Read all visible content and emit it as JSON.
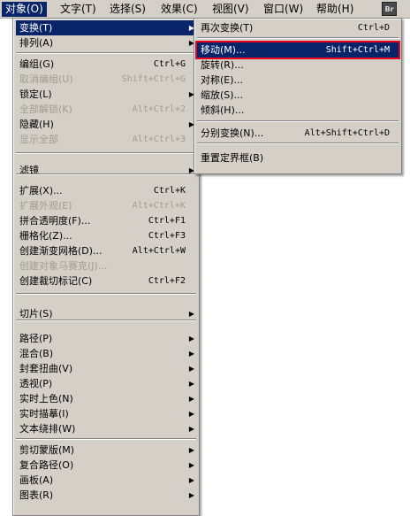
{
  "menubar": {
    "items": [
      "对象(O)",
      "文字(T)",
      "选择(S)",
      "效果(C)",
      "视图(V)",
      "窗口(W)",
      "帮助(H)"
    ],
    "bridge_icon": "Br"
  },
  "main_menu": [
    {
      "label": "变换(T)",
      "shortcut": "",
      "submenu": true,
      "disabled": false,
      "highlight": true
    },
    {
      "label": "排列(A)",
      "shortcut": "",
      "submenu": true,
      "disabled": false
    },
    {
      "label": "编组(G)",
      "shortcut": "Ctrl+G",
      "submenu": false,
      "disabled": false
    },
    {
      "label": "取消编组(U)",
      "shortcut": "Shift+Ctrl+G",
      "submenu": false,
      "disabled": true
    },
    {
      "label": "锁定(L)",
      "shortcut": "",
      "submenu": true,
      "disabled": false
    },
    {
      "label": "全部解锁(K)",
      "shortcut": "Alt+Ctrl+2",
      "submenu": false,
      "disabled": true
    },
    {
      "label": "隐藏(H)",
      "shortcut": "",
      "submenu": true,
      "disabled": false
    },
    {
      "label": "显示全部",
      "shortcut": "Alt+Ctrl+3",
      "submenu": false,
      "disabled": true
    },
    {
      "label": "滤镜",
      "shortcut": "",
      "submenu": true,
      "disabled": false
    },
    {
      "label": "扩展(X)...",
      "shortcut": "Ctrl+K",
      "submenu": false,
      "disabled": false
    },
    {
      "label": "扩展外观(E)",
      "shortcut": "Alt+Ctrl+K",
      "submenu": false,
      "disabled": true
    },
    {
      "label": "拼合透明度(F)...",
      "shortcut": "Ctrl+F1",
      "submenu": false,
      "disabled": false
    },
    {
      "label": "栅格化(Z)...",
      "shortcut": "Ctrl+F3",
      "submenu": false,
      "disabled": false
    },
    {
      "label": "创建渐变网格(D)...",
      "shortcut": "Alt+Ctrl+W",
      "submenu": false,
      "disabled": false
    },
    {
      "label": "创建对象马赛克(J)...",
      "shortcut": "",
      "submenu": false,
      "disabled": true
    },
    {
      "label": "创建裁切标记(C)",
      "shortcut": "Ctrl+F2",
      "submenu": false,
      "disabled": false
    },
    {
      "label": "切片(S)",
      "shortcut": "",
      "submenu": true,
      "disabled": false
    },
    {
      "label": "路径(P)",
      "shortcut": "",
      "submenu": true,
      "disabled": false
    },
    {
      "label": "混合(B)",
      "shortcut": "",
      "submenu": true,
      "disabled": false
    },
    {
      "label": "封套扭曲(V)",
      "shortcut": "",
      "submenu": true,
      "disabled": false
    },
    {
      "label": "透视(P)",
      "shortcut": "",
      "submenu": true,
      "disabled": false
    },
    {
      "label": "实时上色(N)",
      "shortcut": "",
      "submenu": true,
      "disabled": false
    },
    {
      "label": "实时描摹(I)",
      "shortcut": "",
      "submenu": true,
      "disabled": false
    },
    {
      "label": "文本绕排(W)",
      "shortcut": "",
      "submenu": true,
      "disabled": false
    },
    {
      "label": "剪切蒙版(M)",
      "shortcut": "",
      "submenu": true,
      "disabled": false
    },
    {
      "label": "复合路径(O)",
      "shortcut": "",
      "submenu": true,
      "disabled": false
    },
    {
      "label": "画板(A)",
      "shortcut": "",
      "submenu": true,
      "disabled": false
    },
    {
      "label": "图表(R)",
      "shortcut": "",
      "submenu": true,
      "disabled": false
    }
  ],
  "sub_menu": [
    {
      "label": "再次变换(T)",
      "shortcut": "Ctrl+D"
    },
    {
      "label": "移动(M)...",
      "shortcut": "Shift+Ctrl+M",
      "selected": true
    },
    {
      "label": "旋转(R)...",
      "shortcut": ""
    },
    {
      "label": "对称(E)...",
      "shortcut": ""
    },
    {
      "label": "缩放(S)...",
      "shortcut": ""
    },
    {
      "label": "倾斜(H)...",
      "shortcut": ""
    },
    {
      "label": "分别变换(N)...",
      "shortcut": "Alt+Shift+Ctrl+D"
    },
    {
      "label": "重置定界框(B)",
      "shortcut": ""
    }
  ],
  "arrow_glyph": "▶",
  "colors": {
    "highlight": "#0a246a",
    "outline": "#e8001c",
    "menu_bg": "#d4d0c8"
  }
}
